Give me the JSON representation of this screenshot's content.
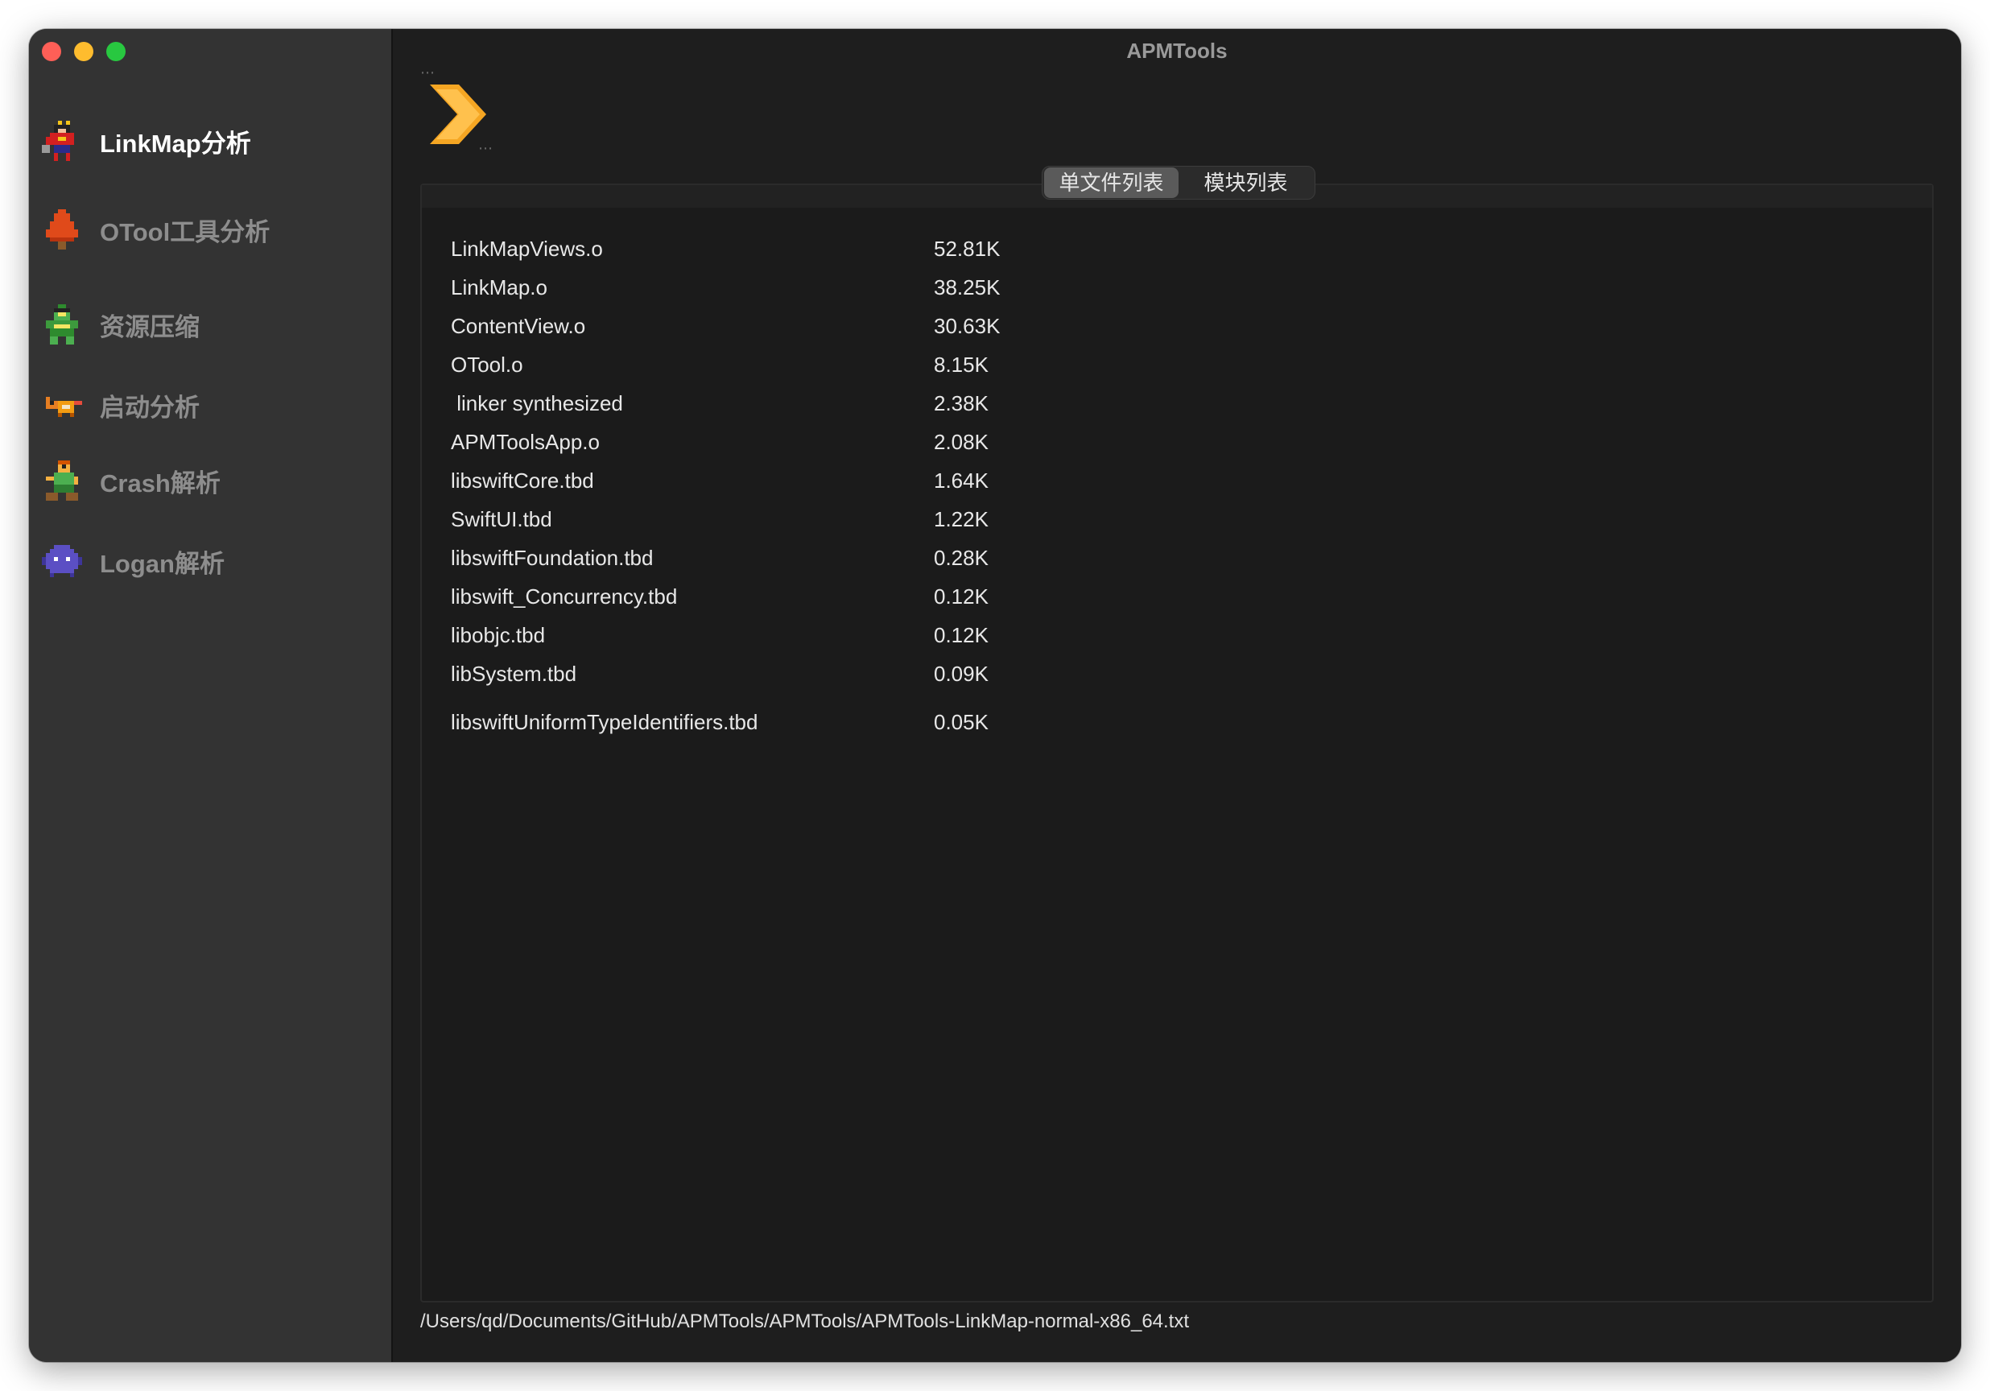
{
  "window": {
    "title": "APMTools"
  },
  "sidebar": {
    "items": [
      {
        "label": "LinkMap分析",
        "icon": "pixel-hero-red-icon",
        "active": true
      },
      {
        "label": "OTool工具分析",
        "icon": "pixel-tree-icon",
        "active": false
      },
      {
        "label": "资源压缩",
        "icon": "pixel-frog-icon",
        "active": false
      },
      {
        "label": "启动分析",
        "icon": "pixel-fox-icon",
        "active": false
      },
      {
        "label": "Crash解析",
        "icon": "pixel-goblin-icon",
        "active": false
      },
      {
        "label": "Logan解析",
        "icon": "pixel-blob-icon",
        "active": false
      }
    ]
  },
  "toolbar": {
    "toggle_icon": "chevron-right-icon"
  },
  "segmented": {
    "options": [
      "单文件列表",
      "模块列表"
    ],
    "selected": "单文件列表"
  },
  "table": {
    "rows": [
      {
        "name": "LinkMapViews.o",
        "size": "52.81K"
      },
      {
        "name": "LinkMap.o",
        "size": "38.25K"
      },
      {
        "name": "ContentView.o",
        "size": "30.63K"
      },
      {
        "name": "OTool.o",
        "size": "8.15K"
      },
      {
        "name": " linker synthesized",
        "size": "2.38K"
      },
      {
        "name": "APMToolsApp.o",
        "size": "2.08K"
      },
      {
        "name": "libswiftCore.tbd",
        "size": "1.64K"
      },
      {
        "name": "SwiftUI.tbd",
        "size": "1.22K"
      },
      {
        "name": "libswiftFoundation.tbd",
        "size": "0.28K"
      },
      {
        "name": "libswift_Concurrency.tbd",
        "size": "0.12K"
      },
      {
        "name": "libobjc.tbd",
        "size": "0.12K"
      },
      {
        "name": "libSystem.tbd",
        "size": "0.09K"
      },
      {
        "name": "libswiftUniformTypeIdentifiers.tbd",
        "size": "0.05K"
      }
    ]
  },
  "status": {
    "path": "/Users/qd/Documents/GitHub/APMTools/APMTools/APMTools-LinkMap-normal-x86_64.txt"
  },
  "colors": {
    "accent_chevron": "#f5a623",
    "sidebar_bg": "#333333",
    "content_bg": "#1e1e1e"
  }
}
